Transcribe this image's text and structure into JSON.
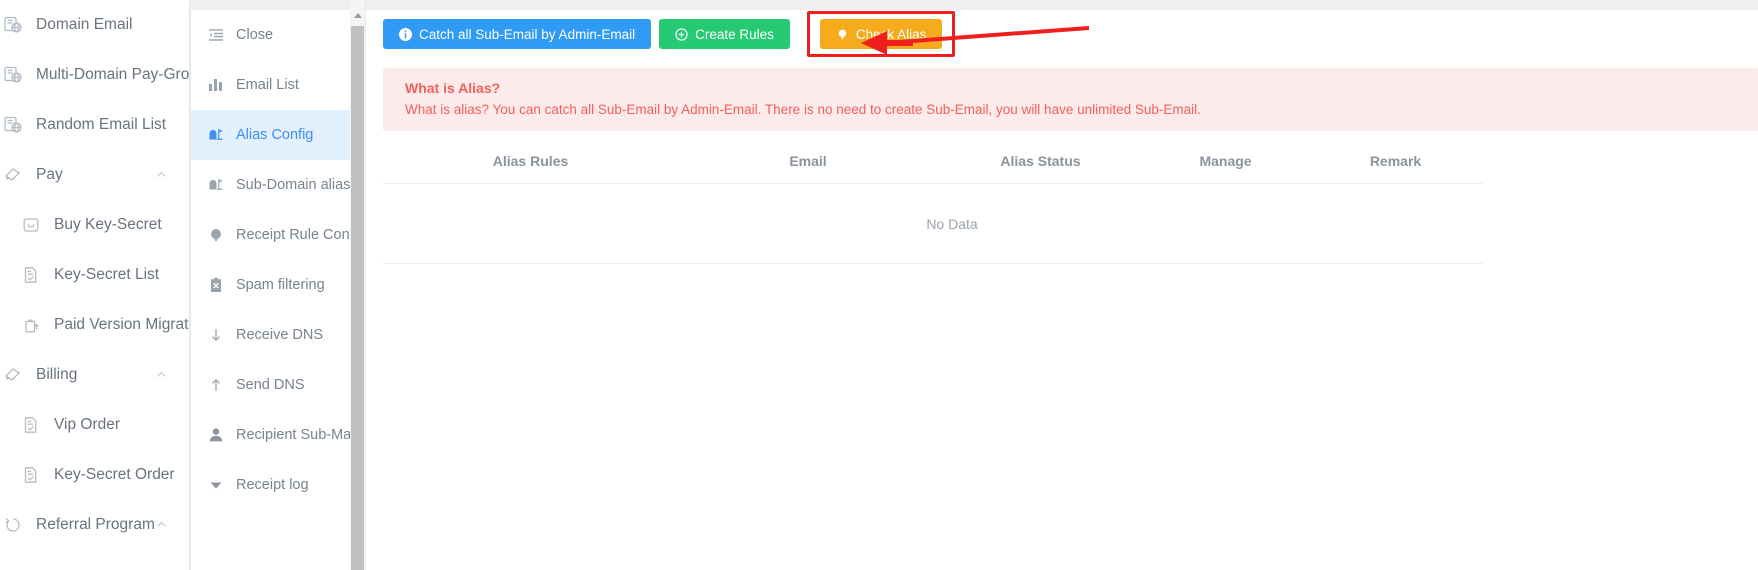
{
  "colors": {
    "accent_blue": "#2f9bf4",
    "accent_green": "#25ca72",
    "accent_orange": "#f5ab1c",
    "alert_bg": "#fdeaea",
    "alert_text": "#f2615c",
    "highlight_red": "#f01f1f",
    "active_item_bg": "#e3f0fd",
    "active_item_text": "#3e8ef7"
  },
  "primary_sidebar": {
    "items": [
      {
        "label": "Domain Email",
        "icon": "domain-email-icon",
        "sub": false,
        "caret": ""
      },
      {
        "label": "Multi-Domain Pay-Group",
        "icon": "domain-email-icon",
        "sub": false,
        "caret": ""
      },
      {
        "label": "Random Email List",
        "icon": "domain-email-icon",
        "sub": false,
        "caret": ""
      },
      {
        "label": "Pay",
        "icon": "pay-icon",
        "sub": false,
        "caret": "chevron-up-icon"
      },
      {
        "label": "Buy Key-Secret",
        "icon": "wallet-icon",
        "sub": true,
        "caret": ""
      },
      {
        "label": "Key-Secret List",
        "icon": "list-doc-icon",
        "sub": true,
        "caret": ""
      },
      {
        "label": "Paid Version Migration",
        "icon": "upload-bag-icon",
        "sub": true,
        "caret": ""
      },
      {
        "label": "Billing",
        "icon": "pay-icon",
        "sub": false,
        "caret": "chevron-up-icon"
      },
      {
        "label": "Vip Order",
        "icon": "list-doc-icon",
        "sub": true,
        "caret": ""
      },
      {
        "label": "Key-Secret Order",
        "icon": "list-doc-icon",
        "sub": true,
        "caret": ""
      },
      {
        "label": "Referral Program",
        "icon": "referral-icon",
        "sub": false,
        "caret": "chevron-up-icon"
      }
    ]
  },
  "secondary_menu": {
    "items": [
      {
        "label": "Close",
        "icon": "collapse-menu-icon",
        "active": false
      },
      {
        "label": "Email List",
        "icon": "bar-chart-icon",
        "active": false
      },
      {
        "label": "Alias Config",
        "icon": "mailbox-icon",
        "active": true
      },
      {
        "label": "Sub-Domain alias",
        "icon": "mailbox-icon",
        "active": false
      },
      {
        "label": "Receipt Rule Config",
        "icon": "bulb-icon",
        "active": false
      },
      {
        "label": "Spam filtering",
        "icon": "clipboard-x-icon",
        "active": false
      },
      {
        "label": "Receive DNS",
        "icon": "arrow-down-icon",
        "active": false
      },
      {
        "label": "Send DNS",
        "icon": "arrow-up-icon",
        "active": false
      },
      {
        "label": "Recipient Sub-Mail",
        "icon": "user-icon",
        "active": false
      },
      {
        "label": "Receipt log",
        "icon": "triangle-down-icon",
        "active": false
      }
    ]
  },
  "toolbar": {
    "catch_all_label": "Catch all Sub-Email by Admin-Email",
    "catch_all_icon": "info-circle-icon",
    "create_rules_label": "Create Rules",
    "create_rules_icon": "plus-circle-icon",
    "check_alias_label": "Check Alias",
    "check_alias_icon": "bulb-icon",
    "annotation_icon": "red-arrow-left-icon"
  },
  "alert": {
    "title": "What is Alias?",
    "text": "What is alias? You can catch all Sub-Email by Admin-Email. There is no need to create Sub-Email, you will have unlimited Sub-Email."
  },
  "table": {
    "columns": [
      "Alias Rules",
      "Email",
      "Alias Status",
      "Manage",
      "Remark"
    ],
    "rows": [],
    "empty_text": "No Data"
  }
}
